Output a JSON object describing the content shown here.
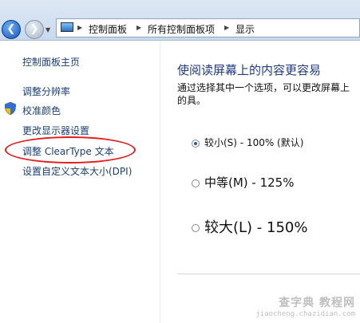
{
  "breadcrumb": [
    "控制面板",
    "所有控制面板项",
    "显示"
  ],
  "sidebar": {
    "home": "控制面板主页",
    "items": [
      "调整分辨率",
      "校准颜色",
      "更改显示器设置",
      "调整 ClearType 文本",
      "设置自定义文本大小(DPI)"
    ]
  },
  "main": {
    "title": "使阅读屏幕上的内容更容易",
    "description": "通过选择其中一个选项，可以更改屏幕上的具。",
    "options": [
      {
        "label": "较小(S) - 100% (默认)",
        "selected": true
      },
      {
        "label": "中等(M) - 125%",
        "selected": false
      },
      {
        "label": "较大(L) - 150%",
        "selected": false
      }
    ]
  },
  "watermark": {
    "line1": "查字典 教程网",
    "line2": "jiaocheng.chazidian.com"
  },
  "colors": {
    "link": "#1a3f79",
    "title": "#1f3b88",
    "highlight": "#e21c1c"
  }
}
